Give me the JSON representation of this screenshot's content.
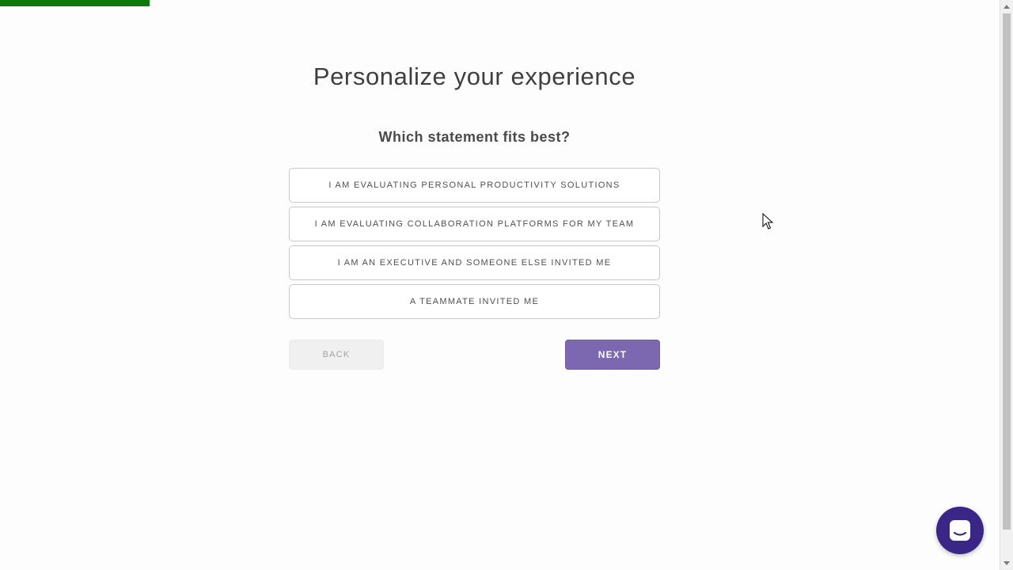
{
  "progress": {
    "value": 0.148,
    "color": "#0b7a0b"
  },
  "title": "Personalize your experience",
  "question": "Which statement fits best?",
  "options": [
    {
      "label": "I AM EVALUATING PERSONAL PRODUCTIVITY SOLUTIONS"
    },
    {
      "label": "I AM EVALUATING COLLABORATION PLATFORMS FOR MY TEAM"
    },
    {
      "label": "I AM AN EXECUTIVE AND SOMEONE ELSE INVITED ME"
    },
    {
      "label": "A TEAMMATE INVITED ME"
    }
  ],
  "buttons": {
    "back_label": "BACK",
    "next_label": "NEXT"
  },
  "colors": {
    "accent": "#7b68b0",
    "chat_launcher": "#3a2686"
  },
  "icons": {
    "chat": "chat-bubble-icon",
    "cursor": "mouse-pointer-icon"
  }
}
